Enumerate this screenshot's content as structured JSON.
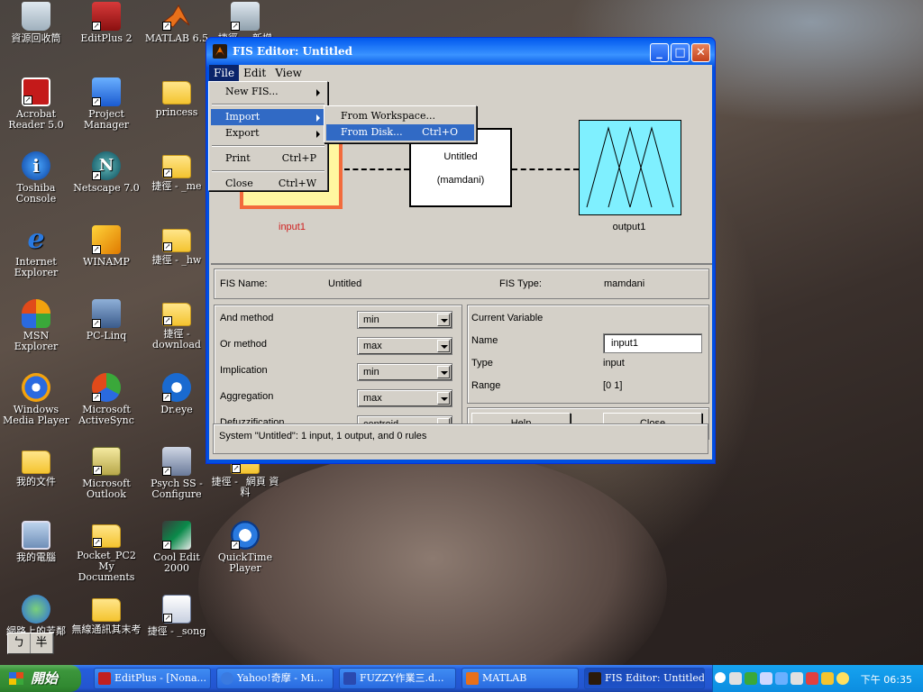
{
  "desktop": {
    "icons": [
      {
        "label": "資源回收筒",
        "icon": "recycle-bin-icon"
      },
      {
        "label": "EditPlus 2",
        "icon": "editplus-icon"
      },
      {
        "label": "MATLAB 6.5",
        "icon": "matlab-icon"
      },
      {
        "label": "捷徑 - _新增",
        "icon": "shortcut-icon"
      },
      {
        "label": "Acrobat Reader 5.0",
        "icon": "acrobat-icon"
      },
      {
        "label": "Project Manager",
        "icon": "project-manager-icon"
      },
      {
        "label": "princess",
        "icon": "folder-icon"
      },
      {
        "label": "Toshiba Console",
        "icon": "toshiba-icon"
      },
      {
        "label": "Netscape 7.0",
        "icon": "netscape-icon"
      },
      {
        "label": "捷徑 - _me",
        "icon": "folder-icon"
      },
      {
        "label": "Internet Explorer",
        "icon": "ie-icon"
      },
      {
        "label": "WINAMP",
        "icon": "winamp-icon"
      },
      {
        "label": "捷徑 - _hw",
        "icon": "folder-icon"
      },
      {
        "label": "MSN Explorer",
        "icon": "msn-icon"
      },
      {
        "label": "PC-Linq",
        "icon": "pc-linq-icon"
      },
      {
        "label": "捷徑 - download",
        "icon": "folder-icon"
      },
      {
        "label": "Windows Media Player",
        "icon": "media-player-icon"
      },
      {
        "label": "Microsoft ActiveSync",
        "icon": "activesync-icon"
      },
      {
        "label": "Dr.eye",
        "icon": "dreye-icon"
      },
      {
        "label": "我的文件",
        "icon": "my-documents-icon"
      },
      {
        "label": "Microsoft Outlook",
        "icon": "outlook-icon"
      },
      {
        "label": "Psych SS - Configure",
        "icon": "psych-icon"
      },
      {
        "label": "捷徑 - _網頁 資料",
        "icon": "folder-icon"
      },
      {
        "label": "我的電腦",
        "icon": "my-computer-icon"
      },
      {
        "label": "Pocket_PC2 My Documents",
        "icon": "pocketpc-icon"
      },
      {
        "label": "Cool Edit 2000",
        "icon": "cool-edit-icon"
      },
      {
        "label": "QuickTime Player",
        "icon": "quicktime-icon"
      },
      {
        "label": "網路上的芳鄰",
        "icon": "network-icon"
      },
      {
        "label": "無線通訊其末考",
        "icon": "folder-icon"
      },
      {
        "label": "捷徑 - _song",
        "icon": "shortcut-icon"
      }
    ]
  },
  "window": {
    "title": "FIS Editor: Untitled",
    "menubar": [
      "File",
      "Edit",
      "View"
    ],
    "file_menu": {
      "new_fis": "New FIS...",
      "import": "Import",
      "export": "Export",
      "print": "Print",
      "print_shortcut": "Ctrl+P",
      "close": "Close",
      "close_shortcut": "Ctrl+W"
    },
    "import_menu": {
      "from_workspace": "From Workspace...",
      "from_disk": "From Disk...",
      "from_disk_shortcut": "Ctrl+O"
    },
    "diagram": {
      "input_label": "input1",
      "system_name": "Untitled",
      "system_type": "(mamdani)",
      "output_label": "output1"
    },
    "info": {
      "fis_name_label": "FIS Name:",
      "fis_name_value": "Untitled",
      "fis_type_label": "FIS Type:",
      "fis_type_value": "mamdani"
    },
    "methods": [
      {
        "label": "And method",
        "value": "min"
      },
      {
        "label": "Or method",
        "value": "max"
      },
      {
        "label": "Implication",
        "value": "min"
      },
      {
        "label": "Aggregation",
        "value": "max"
      },
      {
        "label": "Defuzzification",
        "value": "centroid"
      }
    ],
    "current_variable": {
      "heading": "Current Variable",
      "name_label": "Name",
      "name_value": "input1",
      "type_label": "Type",
      "type_value": "input",
      "range_label": "Range",
      "range_value": "[0 1]"
    },
    "buttons": {
      "help": "Help",
      "close": "Close"
    },
    "status": "System \"Untitled\": 1 input, 1 output, and 0 rules"
  },
  "ime": [
    "ㄅ",
    "半"
  ],
  "taskbar": {
    "start_label": "開始",
    "tasks": [
      {
        "label": "EditPlus - [Nona...",
        "active": false
      },
      {
        "label": "Yahoo!奇摩 - Mi...",
        "active": false
      },
      {
        "label": "FUZZY作業三.d...",
        "active": false
      },
      {
        "label": "MATLAB",
        "active": false
      },
      {
        "label": "FIS Editor: Untitled",
        "active": true
      }
    ],
    "clock": "下午 06:35"
  }
}
